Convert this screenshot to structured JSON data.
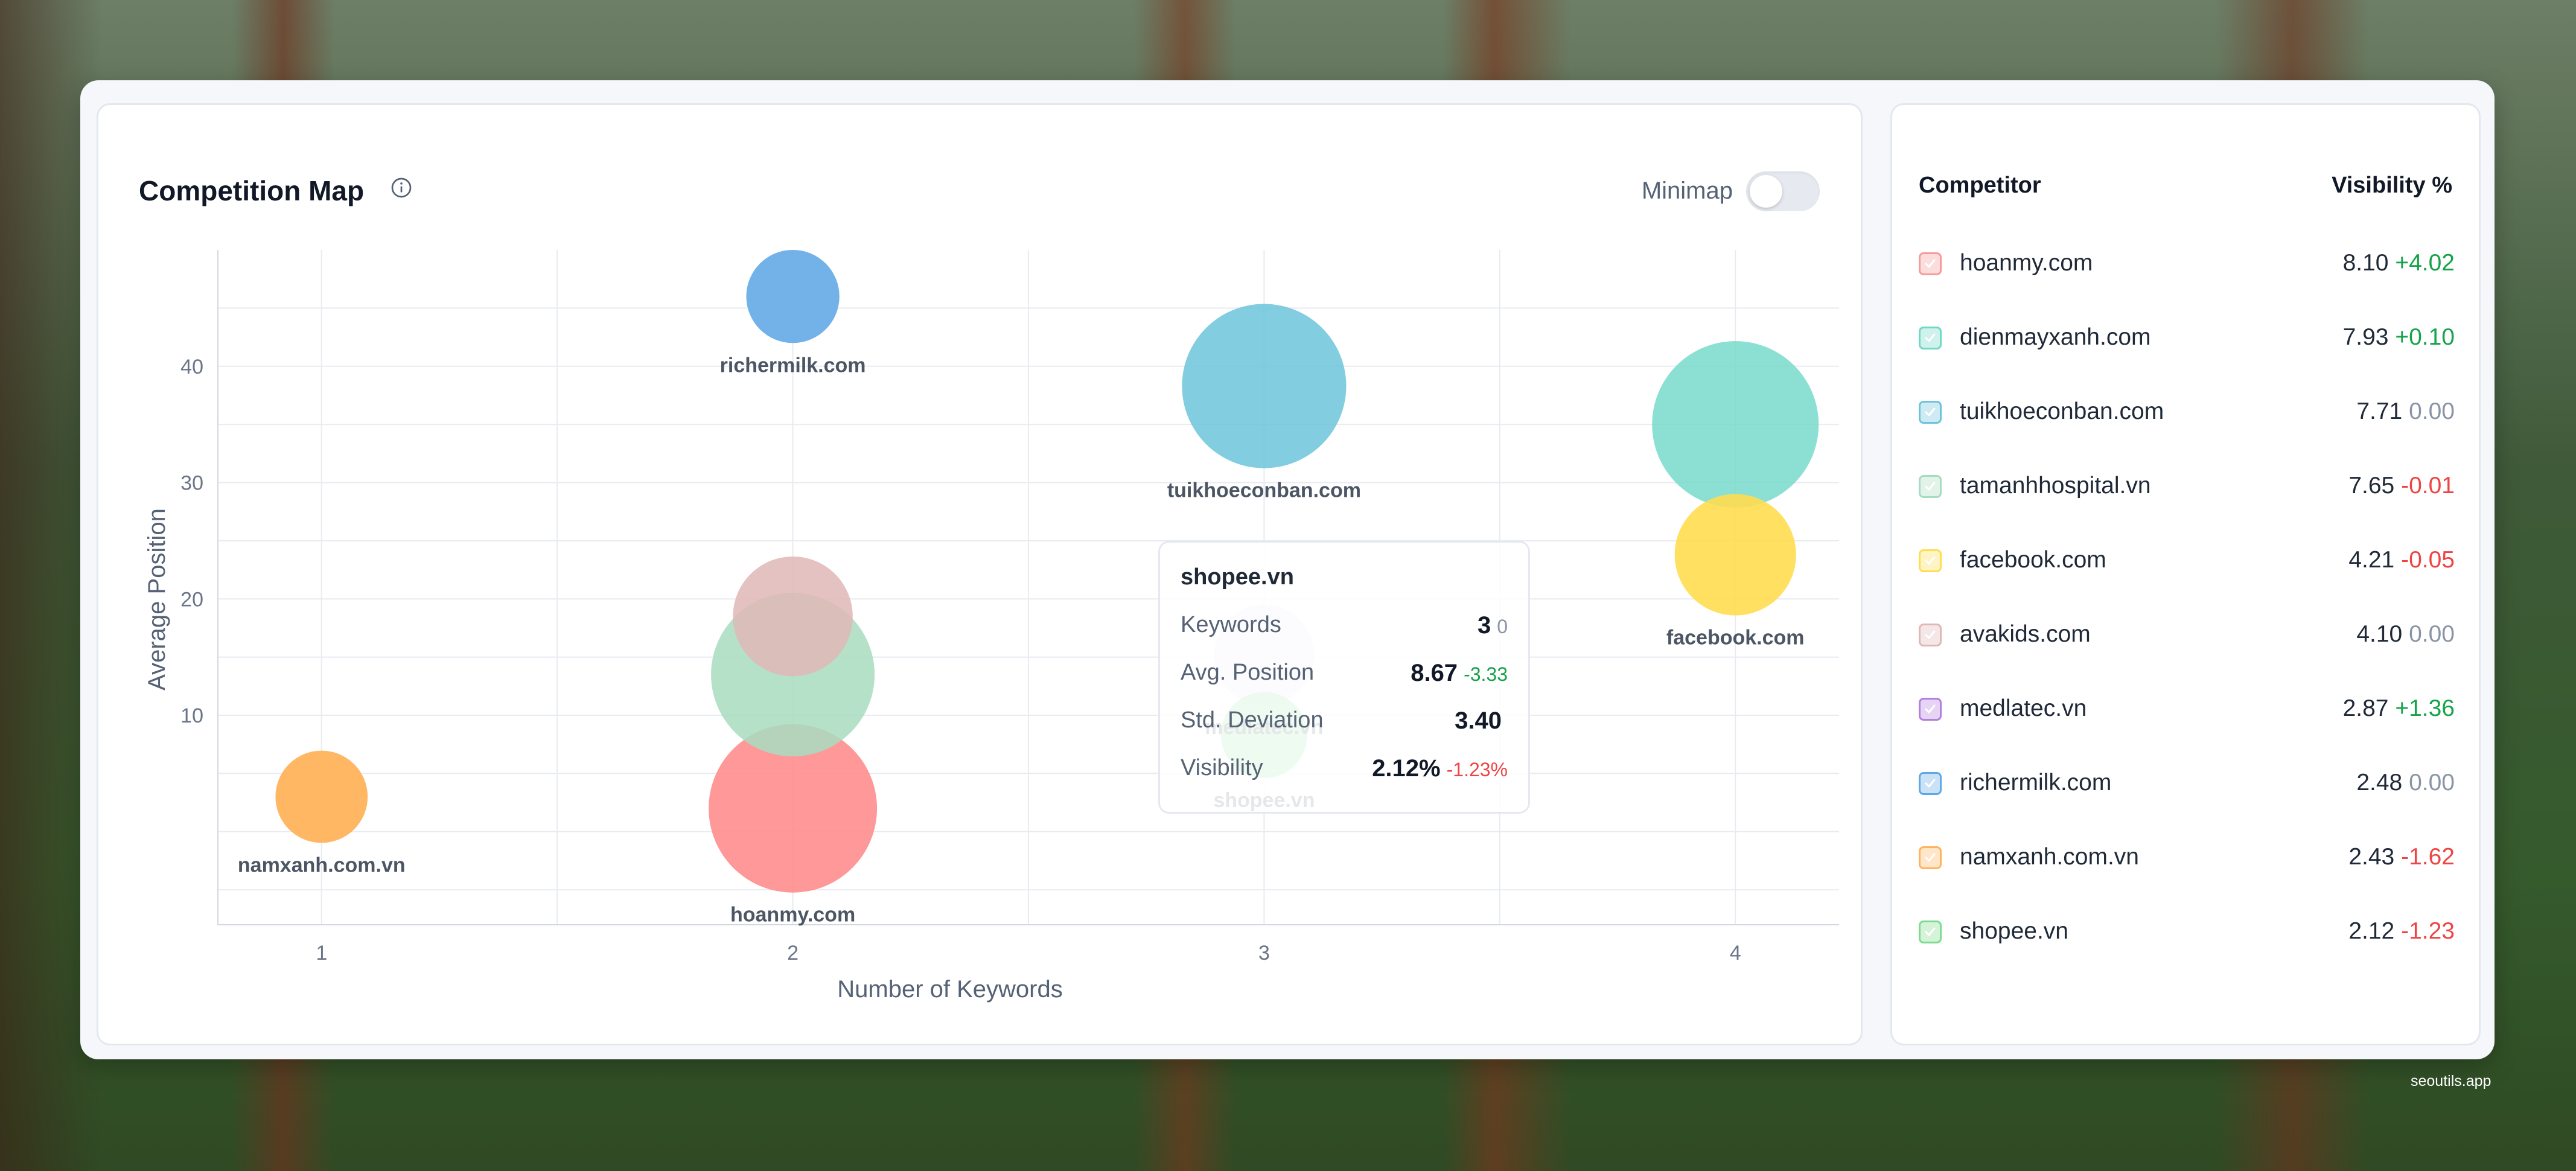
{
  "app": {
    "title": "Competition Map",
    "minimap_label": "Minimap",
    "footer": "seoutils.app"
  },
  "colors": {
    "positive": "#16a34a",
    "negative": "#ef4444",
    "neutral": "#8a94a5"
  },
  "chart_data": {
    "type": "scatter",
    "title": "Competition Map",
    "xlabel": "Number of Keywords",
    "ylabel": "Average Position",
    "xlim": [
      0.78,
      4.22
    ],
    "ylim": [
      -8,
      50
    ],
    "x_ticks": [
      1,
      2,
      3,
      4
    ],
    "y_ticks": [
      10,
      20,
      30,
      40
    ],
    "grid": true,
    "series": [
      {
        "name": "hoanmy.com",
        "x": 2,
        "y": 2,
        "visibility": 8.1,
        "color": "#ff8a8a",
        "opacity": 0.88,
        "show_label": true
      },
      {
        "name": "dienmayxanh.com",
        "x": 4,
        "y": 35,
        "visibility": 7.93,
        "color": "#6fd8c8",
        "opacity": 0.8,
        "show_label": false
      },
      {
        "name": "tuikhoeconban.com",
        "x": 3,
        "y": 38.3,
        "visibility": 7.71,
        "color": "#6cc4da",
        "opacity": 0.85,
        "show_label": true
      },
      {
        "name": "tamanhhospital.vn",
        "x": 2,
        "y": 13.5,
        "visibility": 7.65,
        "color": "#a8dcc0",
        "opacity": 0.85,
        "show_label": false
      },
      {
        "name": "facebook.com",
        "x": 4,
        "y": 23.8,
        "visibility": 4.21,
        "color": "#ffdd4f",
        "opacity": 0.9,
        "show_label": true
      },
      {
        "name": "avakids.com",
        "x": 2,
        "y": 18.5,
        "visibility": 4.1,
        "color": "#e0b7b7",
        "opacity": 0.85,
        "show_label": false
      },
      {
        "name": "medlatec.vn",
        "x": 3,
        "y": 15.2,
        "visibility": 2.87,
        "color": "#e5dcf0",
        "opacity": 0.9,
        "show_label": true
      },
      {
        "name": "richermilk.com",
        "x": 2,
        "y": 46,
        "visibility": 2.48,
        "color": "#6aaee8",
        "opacity": 0.95,
        "show_label": true
      },
      {
        "name": "namxanh.com.vn",
        "x": 1,
        "y": 3,
        "visibility": 2.43,
        "color": "#ffb35c",
        "opacity": 0.95,
        "show_label": true
      },
      {
        "name": "shopee.vn",
        "x": 3,
        "y": 8.3,
        "visibility": 2.12,
        "color": "#7ddc8e",
        "opacity": 0.95,
        "show_label": true
      }
    ]
  },
  "tooltip": {
    "title": "shopee.vn",
    "rows": [
      {
        "label": "Keywords",
        "value": "3",
        "delta": "0",
        "delta_class": "neu"
      },
      {
        "label": "Avg. Position",
        "value": "8.67",
        "delta": "-3.33",
        "delta_class": "pos"
      },
      {
        "label": "Std. Deviation",
        "value": "3.40",
        "delta": "",
        "delta_class": "neu"
      },
      {
        "label": "Visibility",
        "value": "2.12%",
        "delta": "-1.23%",
        "delta_class": "neg"
      }
    ]
  },
  "legend": {
    "header_competitor": "Competitor",
    "header_visibility": "Visibility %",
    "items": [
      {
        "name": "hoanmy.com",
        "value": "8.10",
        "delta": "+4.02",
        "delta_class": "pos",
        "color": "#f79a9a"
      },
      {
        "name": "dienmayxanh.com",
        "value": "7.93",
        "delta": "+0.10",
        "delta_class": "pos",
        "color": "#6fd8c8"
      },
      {
        "name": "tuikhoeconban.com",
        "value": "7.71",
        "delta": "0.00",
        "delta_class": "neu",
        "color": "#6cc4da"
      },
      {
        "name": "tamanhhospital.vn",
        "value": "7.65",
        "delta": "-0.01",
        "delta_class": "neg",
        "color": "#a8dcc0"
      },
      {
        "name": "facebook.com",
        "value": "4.21",
        "delta": "-0.05",
        "delta_class": "neg",
        "color": "#ffdd4f"
      },
      {
        "name": "avakids.com",
        "value": "4.10",
        "delta": "0.00",
        "delta_class": "neu",
        "color": "#e0b7b7"
      },
      {
        "name": "medlatec.vn",
        "value": "2.87",
        "delta": "+1.36",
        "delta_class": "pos",
        "color": "#b47ee0"
      },
      {
        "name": "richermilk.com",
        "value": "2.48",
        "delta": "0.00",
        "delta_class": "neu",
        "color": "#5fa8e6"
      },
      {
        "name": "namxanh.com.vn",
        "value": "2.43",
        "delta": "-1.62",
        "delta_class": "neg",
        "color": "#ffb35c"
      },
      {
        "name": "shopee.vn",
        "value": "2.12",
        "delta": "-1.23",
        "delta_class": "neg",
        "color": "#7ddc8e"
      }
    ]
  }
}
